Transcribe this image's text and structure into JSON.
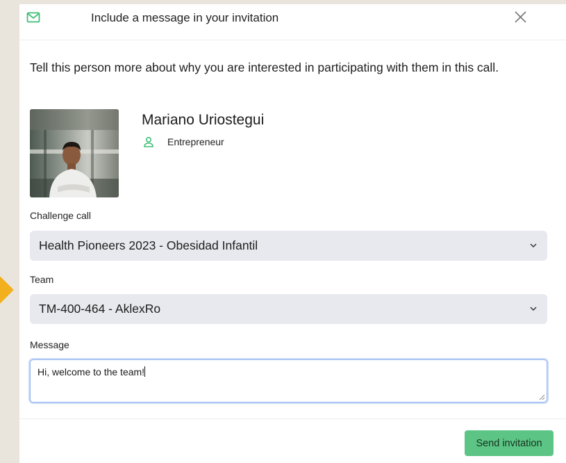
{
  "modal": {
    "title": "Include a message in your invitation",
    "intro": "Tell this person more about why you are interested in participating with them in this call."
  },
  "person": {
    "name": "Mariano Uriostegui",
    "role": "Entrepreneur"
  },
  "challenge": {
    "label": "Challenge call",
    "selected": "Health Pioneers 2023 - Obesidad Infantil"
  },
  "team": {
    "label": "Team",
    "selected": "TM-400-464 - AklexRo"
  },
  "message": {
    "label": "Message",
    "value": "Hi, welcome to the team!"
  },
  "footer": {
    "send_label": "Send invitation"
  },
  "colors": {
    "accent": "#5cc586",
    "select_bg": "#e8e9ee",
    "focus_border": "#97b6ee",
    "backdrop": "#e9e5dc",
    "highlight": "#f2b01e"
  },
  "icons": {
    "header": "mail-icon",
    "close": "close-icon",
    "role": "user-icon",
    "select": "chevron-down-icon"
  }
}
